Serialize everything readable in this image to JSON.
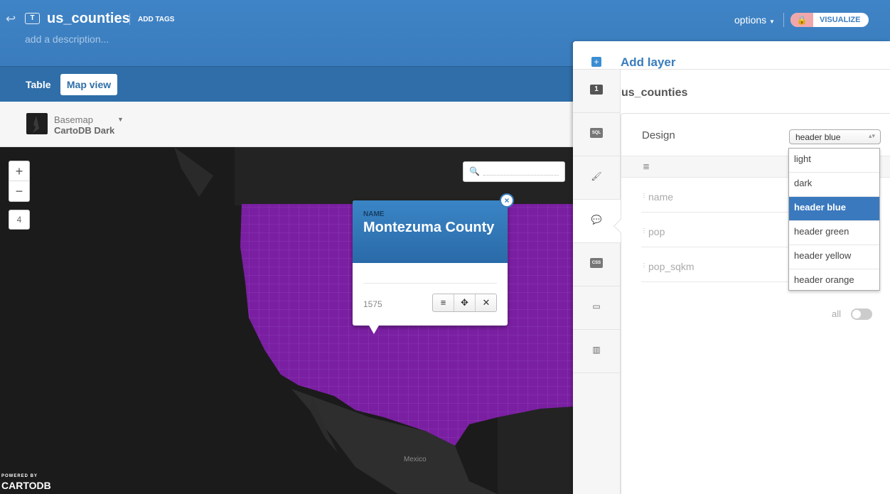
{
  "header": {
    "title": "us_counties",
    "table_badge": "T",
    "add_tags": "ADD TAGS",
    "description_placeholder": "add a description...",
    "options_label": "options",
    "visualize_label": "VISUALIZE"
  },
  "view_tabs": [
    {
      "label": "Table"
    },
    {
      "label": "Map view"
    }
  ],
  "basemap": {
    "label": "Basemap",
    "value": "CartoDB Dark"
  },
  "map": {
    "zoom_level": "4",
    "country_label": "Mexico",
    "powered_by": "POWERED BY",
    "brand": "CARTODB",
    "region_fill": "#7a1fa2"
  },
  "popup": {
    "field_name": "NAME",
    "field_value": "Montezuma County",
    "value": "1575"
  },
  "panel": {
    "add_layer": "Add layer",
    "layer_number": "1",
    "layer_name": "us_counties",
    "rail_icons": [
      "layer-number-icon",
      "sql-icon",
      "wizard-icon",
      "infowindow-icon",
      "css-icon",
      "legend-icon",
      "filters-icon",
      "lamp-icon"
    ],
    "rail_labels": {
      "sql": "SQL",
      "css": "CSS"
    },
    "design_label": "Design",
    "design_value": "header blue",
    "design_options": [
      {
        "label": "light"
      },
      {
        "label": "dark"
      },
      {
        "label": "header blue"
      },
      {
        "label": "header green"
      },
      {
        "label": "header yellow"
      },
      {
        "label": "header orange"
      }
    ],
    "fields": [
      {
        "name": "name"
      },
      {
        "name": "pop"
      },
      {
        "name": "pop_sqkm"
      }
    ],
    "all_label": "all"
  },
  "colors": {
    "header_blue": "#3a7cbd",
    "selected_option": "#3a79be",
    "counties": "#7a1fa2"
  }
}
